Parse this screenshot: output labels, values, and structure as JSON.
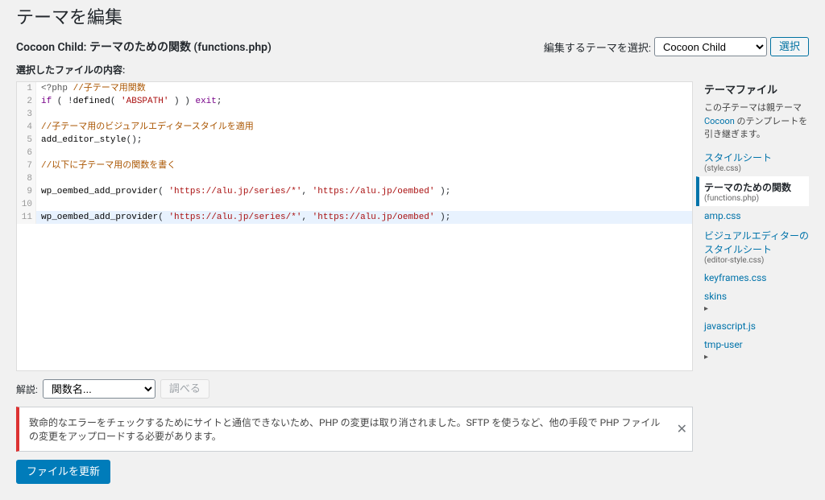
{
  "page": {
    "title": "テーマを編集"
  },
  "header": {
    "theme_name": "Cocoon Child:",
    "file_title": "テーマのための関数 (functions.php)",
    "select_label": "編集するテーマを選択:",
    "selected_theme": "Cocoon Child",
    "select_button": "選択"
  },
  "editor": {
    "file_content_label": "選択したファイルの内容:",
    "lines": [
      {
        "n": 1,
        "segs": [
          {
            "t": "<?php ",
            "c": "cm-php"
          },
          {
            "t": "//子テーマ用関数",
            "c": "cm-com"
          }
        ]
      },
      {
        "n": 2,
        "segs": [
          {
            "t": "if",
            "c": "cm-kw"
          },
          {
            "t": " ( !",
            "c": ""
          },
          {
            "t": "defined",
            "c": "cm-func"
          },
          {
            "t": "( ",
            "c": ""
          },
          {
            "t": "'ABSPATH'",
            "c": "cm-str"
          },
          {
            "t": " ) ) ",
            "c": ""
          },
          {
            "t": "exit",
            "c": "cm-kw"
          },
          {
            "t": ";",
            "c": ""
          }
        ]
      },
      {
        "n": 3,
        "segs": [
          {
            "t": "",
            "c": ""
          }
        ]
      },
      {
        "n": 4,
        "segs": [
          {
            "t": "//子テーマ用のビジュアルエディタースタイルを適用",
            "c": "cm-com"
          }
        ]
      },
      {
        "n": 5,
        "segs": [
          {
            "t": "add_editor_style",
            "c": "cm-func"
          },
          {
            "t": "();",
            "c": ""
          }
        ]
      },
      {
        "n": 6,
        "segs": [
          {
            "t": "",
            "c": ""
          }
        ]
      },
      {
        "n": 7,
        "segs": [
          {
            "t": "//以下に子テーマ用の関数を書く",
            "c": "cm-com"
          }
        ]
      },
      {
        "n": 8,
        "segs": [
          {
            "t": "",
            "c": ""
          }
        ]
      },
      {
        "n": 9,
        "segs": [
          {
            "t": "wp_oembed_add_provider",
            "c": "cm-func"
          },
          {
            "t": "( ",
            "c": ""
          },
          {
            "t": "'https://alu.jp/series/*'",
            "c": "cm-str"
          },
          {
            "t": ", ",
            "c": ""
          },
          {
            "t": "'https://alu.jp/oembed'",
            "c": "cm-str"
          },
          {
            "t": " );",
            "c": ""
          }
        ]
      },
      {
        "n": 10,
        "segs": [
          {
            "t": "",
            "c": ""
          }
        ]
      },
      {
        "n": 11,
        "cursor": true,
        "segs": [
          {
            "t": "wp_oembed_add_provider",
            "c": "cm-func"
          },
          {
            "t": "( ",
            "c": ""
          },
          {
            "t": "'https://alu.jp/series/*'",
            "c": "cm-str"
          },
          {
            "t": ", ",
            "c": ""
          },
          {
            "t": "'https://alu.jp/oembed'",
            "c": "cm-str"
          },
          {
            "t": " );",
            "c": ""
          }
        ]
      }
    ]
  },
  "sidebar": {
    "title": "テーマファイル",
    "desc_pre": "この子テーマは親テーマ ",
    "desc_link": "Cocoon",
    "desc_post": " のテンプレートを引き継ぎます。",
    "files": [
      {
        "label": "スタイルシート",
        "sub": "(style.css)",
        "active": false
      },
      {
        "label": "テーマのための関数",
        "sub": "(functions.php)",
        "active": true
      },
      {
        "label": "amp.css",
        "sub": "",
        "active": false
      },
      {
        "label": "ビジュアルエディターのスタイルシート",
        "sub": "(editor-style.css)",
        "active": false
      },
      {
        "label": "keyframes.css",
        "sub": "",
        "active": false
      },
      {
        "label": "skins",
        "sub": "",
        "active": false,
        "folder": true
      },
      {
        "label": "javascript.js",
        "sub": "",
        "active": false
      },
      {
        "label": "tmp-user",
        "sub": "",
        "active": false,
        "folder": true
      }
    ]
  },
  "docs": {
    "label": "解説:",
    "select_placeholder": "関数名...",
    "lookup_button": "調べる"
  },
  "notice": {
    "text": "致命的なエラーをチェックするためにサイトと通信できないため、PHP の変更は取り消されました。SFTP を使うなど、他の手段で PHP ファイルの変更をアップロードする必要があります。",
    "dismiss": "✕"
  },
  "submit": {
    "button": "ファイルを更新"
  }
}
